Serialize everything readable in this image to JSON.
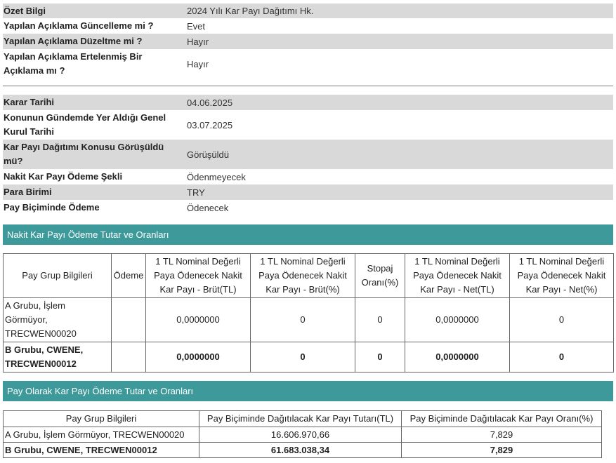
{
  "summary": [
    {
      "label": "Özet Bilgi",
      "value": "2024 Yılı Kar Payı Dağıtımı Hk."
    },
    {
      "label": "Yapılan Açıklama Güncelleme mi ?",
      "value": "Evet"
    },
    {
      "label": "Yapılan Açıklama Düzeltme mi ?",
      "value": "Hayır"
    },
    {
      "label": "Yapılan Açıklama Ertelenmiş Bir Açıklama mı ?",
      "value": "Hayır"
    }
  ],
  "details": [
    {
      "label": "Karar Tarihi",
      "value": "04.06.2025"
    },
    {
      "label": "Konunun Gündemde Yer Aldığı Genel Kurul Tarihi",
      "value": "03.07.2025"
    },
    {
      "label": "Kar Payı Dağıtımı Konusu Görüşüldü mü?",
      "value": "Görüşüldü"
    },
    {
      "label": "Nakit Kar Payı Ödeme Şekli",
      "value": "Ödenmeyecek"
    },
    {
      "label": "Para Birimi",
      "value": "TRY"
    },
    {
      "label": "Pay Biçiminde Ödeme",
      "value": "Ödenecek"
    }
  ],
  "cash_section": {
    "title": "Nakit Kar Payı Ödeme Tutar ve Oranları",
    "headers": [
      "Pay Grup Bilgileri",
      "Ödeme",
      "1 TL Nominal Değerli Paya Ödenecek Nakit Kar Payı - Brüt(TL)",
      "1 TL Nominal Değerli Paya Ödenecek Nakit Kar Payı - Brüt(%)",
      "Stopaj Oranı(%)",
      "1 TL Nominal Değerli Paya Ödenecek Nakit Kar Payı - Net(TL)",
      "1 TL Nominal Değerli Paya Ödenecek Nakit Kar Payı - Net(%)"
    ],
    "rows": [
      [
        "A Grubu, İşlem Görmüyor, TRECWEN00020",
        "",
        "0,0000000",
        "0",
        "0",
        "0,0000000",
        "0"
      ],
      [
        "B Grubu, CWENE, TRECWEN00012",
        "",
        "0,0000000",
        "0",
        "0",
        "0,0000000",
        "0"
      ]
    ]
  },
  "share_section": {
    "title": "Pay Olarak Kar Payı Ödeme Tutar ve Oranları",
    "headers": [
      "Pay Grup Bilgileri",
      "Pay Biçiminde Dağıtılacak Kar Payı Tutarı(TL)",
      "Pay Biçiminde Dağıtılacak Kar Payı Oranı(%)"
    ],
    "rows": [
      [
        "A Grubu, İşlem Görmüyor, TRECWEN00020",
        "16.606.970,66",
        "7,829"
      ],
      [
        "B Grubu, CWENE, TRECWEN00012",
        "61.683.038,34",
        "7,829"
      ]
    ]
  }
}
